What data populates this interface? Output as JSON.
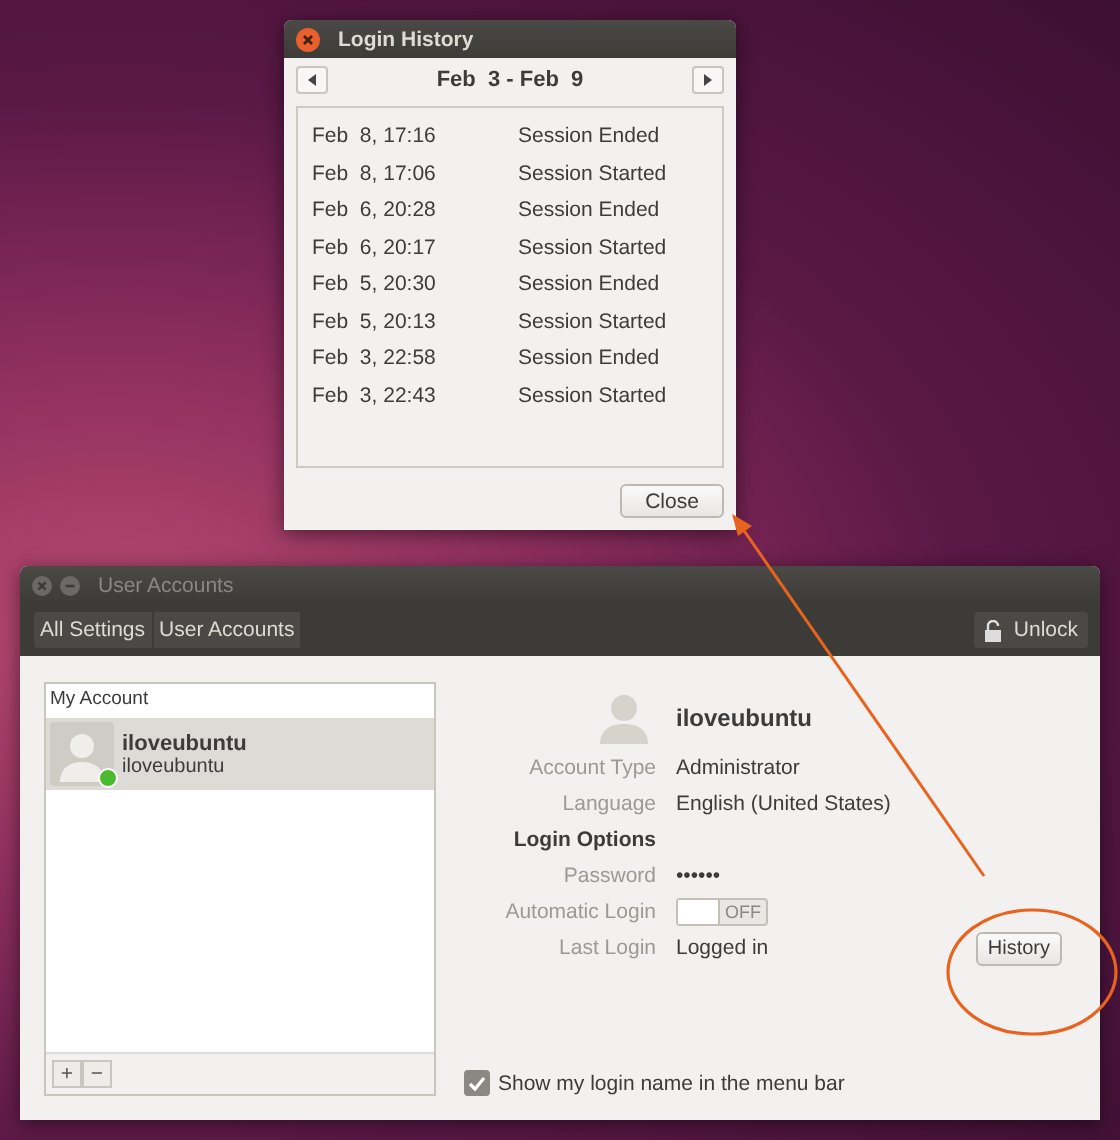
{
  "history_window": {
    "title": "Login History",
    "range": "Feb  3 - Feb  9",
    "close": "Close",
    "entries": [
      {
        "time": "Feb  8, 17:16",
        "event": "Session Ended"
      },
      {
        "time": "Feb  8, 17:06",
        "event": "Session Started"
      },
      {
        "time": "Feb  6, 20:28",
        "event": "Session Ended"
      },
      {
        "time": "Feb  6, 20:17",
        "event": "Session Started"
      },
      {
        "time": "Feb  5, 20:30",
        "event": "Session Ended"
      },
      {
        "time": "Feb  5, 20:13",
        "event": "Session Started"
      },
      {
        "time": "Feb  3, 22:58",
        "event": "Session Ended"
      },
      {
        "time": "Feb  3, 22:43",
        "event": "Session Started"
      }
    ]
  },
  "accounts_window": {
    "title": "User Accounts",
    "breadcrumbs": [
      "All Settings",
      "User Accounts"
    ],
    "unlock": "Unlock",
    "list_header": "My Account",
    "accounts": [
      {
        "name": "iloveubuntu",
        "login": "iloveubuntu",
        "selected": true,
        "online": true
      }
    ],
    "add": "+",
    "remove": "−",
    "user_name": "iloveubuntu",
    "fields": [
      {
        "kind": "text",
        "label": "Account Type",
        "value": "Administrator"
      },
      {
        "kind": "text",
        "label": "Language",
        "value": "English (United States)"
      },
      {
        "kind": "heading",
        "label": "Login Options"
      },
      {
        "kind": "text",
        "label": "Password",
        "value": "••••••"
      },
      {
        "kind": "toggle",
        "label": "Automatic Login",
        "on": false,
        "value": "OFF"
      },
      {
        "kind": "text",
        "label": "Last Login",
        "value": "Logged in",
        "button": "History"
      }
    ],
    "show_name": {
      "label": "Show my login name in the menu bar",
      "checked": true
    }
  }
}
